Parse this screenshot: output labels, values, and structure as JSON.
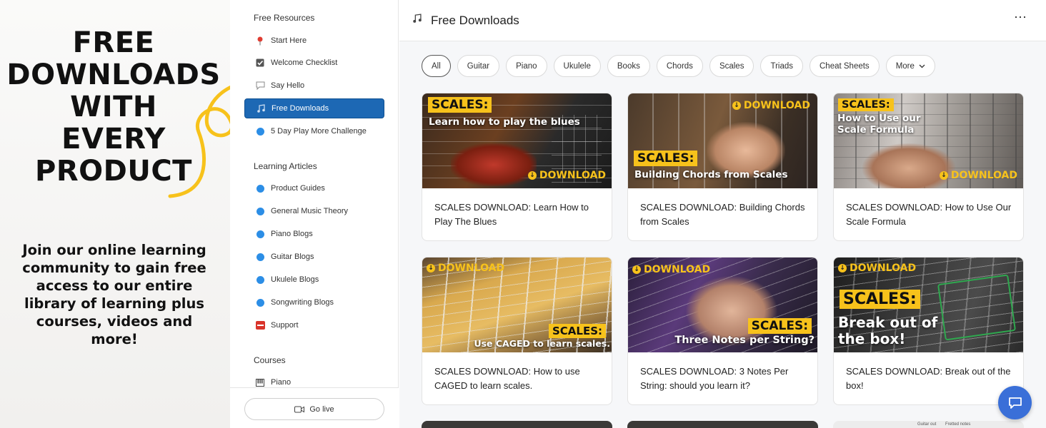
{
  "promo": {
    "headline_line1": "FREE",
    "headline_line2": "DOWNLOADS",
    "headline_line3": "WITH",
    "headline_line4": "EVERY",
    "headline_line5": "PRODUCT",
    "body": "Join our online learning community to gain free access to our entire library of learning plus courses, videos and more!"
  },
  "sidebar": {
    "section1_heading": "Free Resources",
    "section1_items": [
      {
        "label": "Start Here",
        "icon": "pin-icon"
      },
      {
        "label": "Welcome Checklist",
        "icon": "checkbox-icon"
      },
      {
        "label": "Say Hello",
        "icon": "speech-bubble-icon"
      },
      {
        "label": "Free Downloads",
        "icon": "music-notes-icon"
      },
      {
        "label": "5 Day Play More Challenge",
        "icon": "blue-dot-icon"
      }
    ],
    "section2_heading": "Learning Articles",
    "section2_items": [
      {
        "label": "Product Guides",
        "icon": "blue-dot-icon"
      },
      {
        "label": "General Music Theory",
        "icon": "blue-dot-icon"
      },
      {
        "label": "Piano Blogs",
        "icon": "blue-dot-icon"
      },
      {
        "label": "Guitar Blogs",
        "icon": "blue-dot-icon"
      },
      {
        "label": "Ukulele Blogs",
        "icon": "blue-dot-icon"
      },
      {
        "label": "Songwriting Blogs",
        "icon": "blue-dot-icon"
      },
      {
        "label": "Support",
        "icon": "sos-icon"
      }
    ],
    "section3_heading": "Courses",
    "section3_items": [
      {
        "label": "Piano",
        "icon": "piano-icon"
      }
    ],
    "go_live_label": "Go live"
  },
  "main": {
    "title": "Free Downloads",
    "filters": [
      "All",
      "Guitar",
      "Piano",
      "Ukulele",
      "Books",
      "Chords",
      "Scales",
      "Triads",
      "Cheat Sheets",
      "More"
    ],
    "active_filter": "All",
    "cards": [
      {
        "tag": "SCALES:",
        "overlay": "Learn how to play the blues",
        "download": "DOWNLOAD",
        "title": "SCALES DOWNLOAD: Learn How to Play The Blues"
      },
      {
        "tag": "SCALES:",
        "overlay": "Building Chords from Scales",
        "download": "DOWNLOAD",
        "title": "SCALES DOWNLOAD: Building Chords from Scales"
      },
      {
        "tag": "SCALES:",
        "overlay": "How to Use our Scale Formula",
        "download": "DOWNLOAD",
        "title": "SCALES DOWNLOAD: How to Use Our Scale Formula"
      },
      {
        "tag": "SCALES:",
        "overlay": "Use CAGED to learn scales.",
        "download": "DOWNLOAD",
        "title": "SCALES DOWNLOAD: How to use CAGED to learn scales."
      },
      {
        "tag": "SCALES:",
        "overlay": "Three Notes per String?",
        "download": "DOWNLOAD",
        "title": "SCALES DOWNLOAD: 3 Notes Per String: should you learn it?"
      },
      {
        "tag": "SCALES:",
        "overlay": "Break out of the box!",
        "download": "DOWNLOAD",
        "title": "SCALES DOWNLOAD: Break out of the box!"
      }
    ],
    "peek_text": [
      "Guitar out",
      "Fretted notes"
    ]
  },
  "colors": {
    "accent_yellow": "#f7c21b",
    "active_blue": "#1d68b4",
    "chat_blue": "#3a6fd8"
  }
}
